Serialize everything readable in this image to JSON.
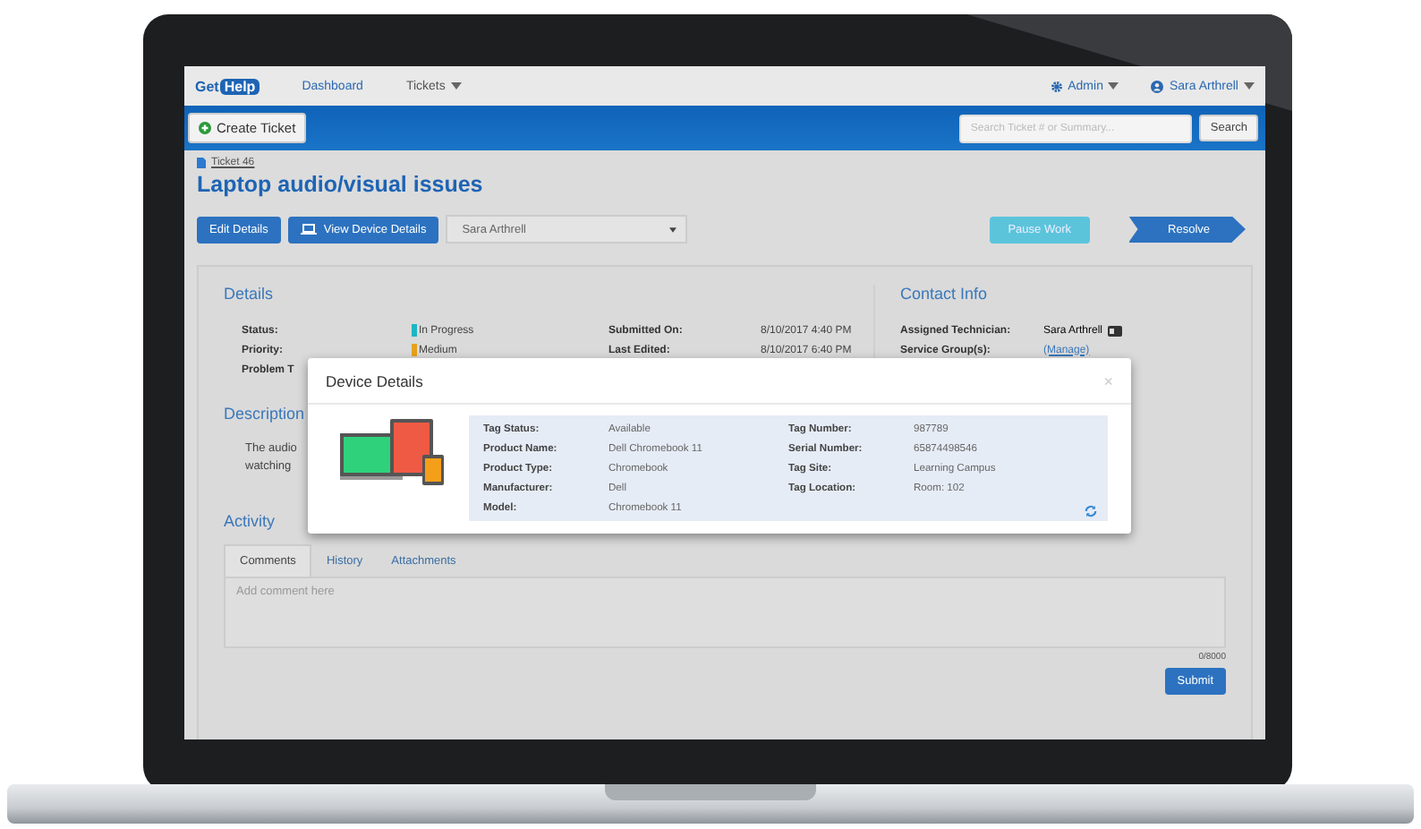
{
  "nav": {
    "logo_left": "Get",
    "logo_right": "Help",
    "links": [
      {
        "label": "Dashboard",
        "dropdown": false
      },
      {
        "label": "Tickets",
        "dropdown": true
      }
    ],
    "right": [
      {
        "label": "Admin"
      },
      {
        "label": "Sara Arthrell"
      }
    ]
  },
  "toolbar": {
    "create_button": "Create Ticket",
    "search": {
      "placeholder": "Search Ticket # or Summary..."
    },
    "search_button": "Search"
  },
  "ticket": {
    "breadcrumb": "Ticket 46",
    "title": "Laptop audio/visual issues",
    "edit_button": "Edit Details",
    "device_button": "View Device Details",
    "assignee": "Sara Arthrell",
    "pause_button": "Pause Work",
    "resolve_button": "Resolve"
  },
  "details": {
    "heading": "Details",
    "fields": [
      {
        "label": "Status:",
        "value": "In Progress",
        "color": "#1fb5c4"
      },
      {
        "label": "Priority:",
        "value": "Medium",
        "color": "#e6a21c"
      },
      {
        "label": "Problem T"
      }
    ],
    "meta": [
      {
        "label": "Submitted On:",
        "value": "8/10/2017 4:40 PM"
      },
      {
        "label": "Last Edited:",
        "value": "8/10/2017 6:40 PM"
      }
    ]
  },
  "description": {
    "heading": "Description",
    "lines": [
      "The audio",
      "watching"
    ]
  },
  "contact": {
    "heading": "Contact Info",
    "fields": [
      {
        "label": "Assigned Technician:",
        "value": "Sara Arthrell",
        "kind": "card"
      },
      {
        "label": "Service Group(s):",
        "value": "(Manage)",
        "kind": "link"
      }
    ]
  },
  "activity": {
    "heading": "Activity",
    "tabs": [
      {
        "label": "Comments",
        "selected": true
      },
      {
        "label": "History",
        "selected": false
      },
      {
        "label": "Attachments",
        "selected": false
      }
    ],
    "comment": {
      "placeholder": "Add comment here"
    },
    "counter": "0/8000",
    "submit": "Submit"
  },
  "modal": {
    "title": "Device Details",
    "close": "×",
    "left": [
      {
        "label": "Tag Status:",
        "value": "Available"
      },
      {
        "label": "Product Name:",
        "value": "Dell Chromebook 11"
      },
      {
        "label": "Product Type:",
        "value": "Chromebook"
      },
      {
        "label": "Manufacturer:",
        "value": "Dell"
      },
      {
        "label": "Model:",
        "value": "Chromebook 11"
      }
    ],
    "right": [
      {
        "label": "Tag Number:",
        "value": "987789"
      },
      {
        "label": "Serial Number:",
        "value": "65874498546"
      },
      {
        "label": "Tag Site:",
        "value": "Learning Campus"
      },
      {
        "label": "Tag Location:",
        "value": "Room: 102"
      }
    ]
  }
}
